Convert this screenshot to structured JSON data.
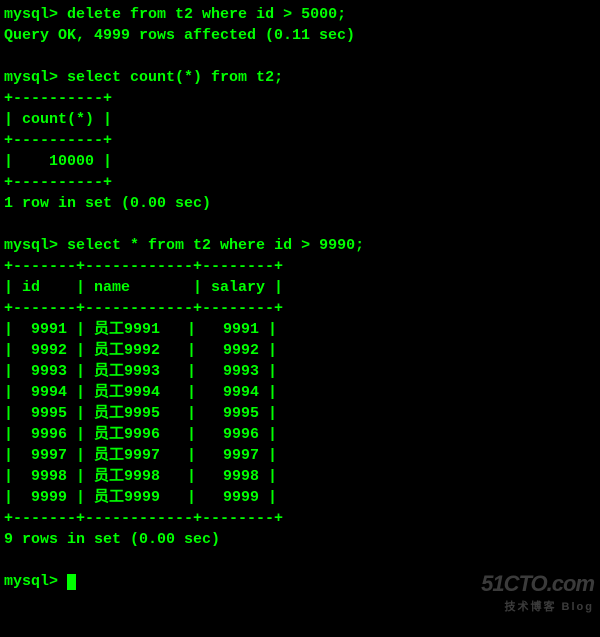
{
  "prompt": "mysql>",
  "cmd1": "delete from t2 where id > 5000;",
  "resp1": "Query OK, 4999 rows affected (0.11 sec)",
  "cmd2": "select count(*) from t2;",
  "tbl1_border": "+----------+",
  "tbl1_header": "| count(*) |",
  "tbl1_row": "|    10000 |",
  "resp2": "1 row in set (0.00 sec)",
  "cmd3": "select * from t2 where id > 9990;",
  "tbl2_border": "+-------+------------+--------+",
  "tbl2_header": "| id    | name       | salary |",
  "tbl2_rows": [
    "|  9991 | 员工9991   |   9991 |",
    "|  9992 | 员工9992   |   9992 |",
    "|  9993 | 员工9993   |   9993 |",
    "|  9994 | 员工9994   |   9994 |",
    "|  9995 | 员工9995   |   9995 |",
    "|  9996 | 员工9996   |   9996 |",
    "|  9997 | 员工9997   |   9997 |",
    "|  9998 | 员工9998   |   9998 |",
    "|  9999 | 员工9999   |   9999 |"
  ],
  "resp3": "9 rows in set (0.00 sec)",
  "chart_data": {
    "type": "table",
    "tables": [
      {
        "title": "count result",
        "columns": [
          "count(*)"
        ],
        "rows": [
          [
            10000
          ]
        ]
      },
      {
        "title": "t2 rows where id > 9990",
        "columns": [
          "id",
          "name",
          "salary"
        ],
        "rows": [
          [
            9991,
            "员工9991",
            9991
          ],
          [
            9992,
            "员工9992",
            9992
          ],
          [
            9993,
            "员工9993",
            9993
          ],
          [
            9994,
            "员工9994",
            9994
          ],
          [
            9995,
            "员工9995",
            9995
          ],
          [
            9996,
            "员工9996",
            9996
          ],
          [
            9997,
            "员工9997",
            9997
          ],
          [
            9998,
            "员工9998",
            9998
          ],
          [
            9999,
            "员工9999",
            9999
          ]
        ]
      }
    ]
  },
  "watermark": {
    "big": "51CTO.com",
    "small": "技术博客  Blog"
  }
}
